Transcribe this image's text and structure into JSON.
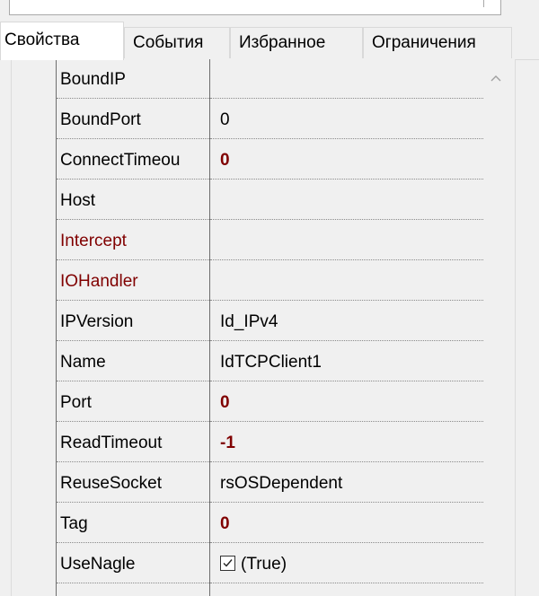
{
  "tabs": [
    {
      "label": "Свойства",
      "active": true
    },
    {
      "label": "События",
      "active": false
    },
    {
      "label": "Избранное",
      "active": false
    },
    {
      "label": "Ограничения",
      "active": false
    }
  ],
  "properties": [
    {
      "name": "BoundIP",
      "value": ""
    },
    {
      "name": "BoundPort",
      "value": "0"
    },
    {
      "name": "ConnectTimeou",
      "value": "0"
    },
    {
      "name": "Host",
      "value": ""
    },
    {
      "name": "Intercept",
      "value": ""
    },
    {
      "name": "IOHandler",
      "value": ""
    },
    {
      "name": "IPVersion",
      "value": "Id_IPv4"
    },
    {
      "name": "Name",
      "value": "IdTCPClient1"
    },
    {
      "name": "Port",
      "value": "0"
    },
    {
      "name": "ReadTimeout",
      "value": "-1"
    },
    {
      "name": "ReuseSocket",
      "value": "rsOSDependent"
    },
    {
      "name": "Tag",
      "value": "0"
    },
    {
      "name": "UseNagle",
      "value": "(True)"
    }
  ],
  "colors": {
    "modified_value": "#800000",
    "event_link": "#800000",
    "grid_line": "#6d6d6d"
  },
  "icons": {
    "checkbox": "checkbox-checked-icon",
    "scroll_up": "chevron-up-icon"
  }
}
